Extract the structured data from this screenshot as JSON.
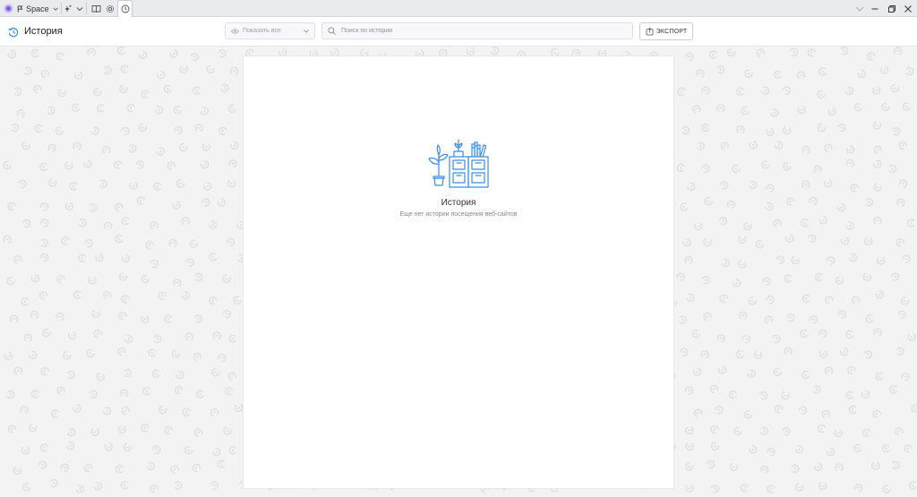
{
  "tabbar": {
    "space_label": "Space"
  },
  "toolbar": {
    "title": "История",
    "filter_label": "Показать все",
    "search_placeholder": "Поиск по истории",
    "export_label": "ЭКСПОРТ"
  },
  "empty_state": {
    "title": "История",
    "subtitle": "Еще нет истории посещения веб-сайтов"
  },
  "colors": {
    "accent": "#3a8ee6",
    "background": "#f3f3f4",
    "pattern": "#d9dadc"
  }
}
